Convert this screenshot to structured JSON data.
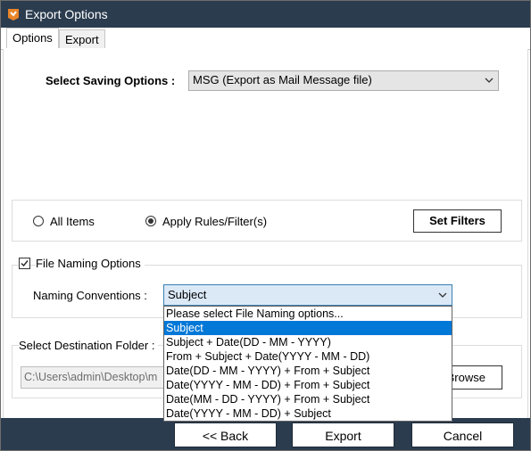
{
  "window": {
    "title": "Export Options"
  },
  "tabs": [
    {
      "label": "Options",
      "active": true
    },
    {
      "label": "Export",
      "active": false
    }
  ],
  "saving": {
    "label": "Select Saving Options :",
    "selected": "MSG (Export as Mail Message file)"
  },
  "filters": {
    "all_items_label": "All Items",
    "apply_rules_label": "Apply Rules/Filter(s)",
    "selected": "apply_rules",
    "set_filters_label": "Set Filters"
  },
  "naming": {
    "checkbox_label": "File Naming Options",
    "checked": true,
    "conventions_label": "Naming Conventions :",
    "selected": "Subject",
    "options": [
      "Please select File Naming options...",
      "Subject",
      "Subject + Date(DD - MM - YYYY)",
      "From + Subject + Date(YYYY - MM - DD)",
      "Date(DD - MM - YYYY) + From + Subject",
      "Date(YYYY - MM - DD) + From + Subject",
      "Date(MM - DD - YYYY) + From + Subject",
      "Date(YYYY - MM - DD) + Subject"
    ],
    "highlighted_index": 1
  },
  "destination": {
    "label": "Select Destination Folder :",
    "path": "C:\\Users\\admin\\Desktop\\m",
    "browse_label": "Browse"
  },
  "footer": {
    "back_label": "<< Back",
    "export_label": "Export",
    "cancel_label": "Cancel"
  },
  "colors": {
    "titlebar": "#2b3c4f",
    "selection": "#0078d7",
    "app_icon": "#e8852a"
  }
}
